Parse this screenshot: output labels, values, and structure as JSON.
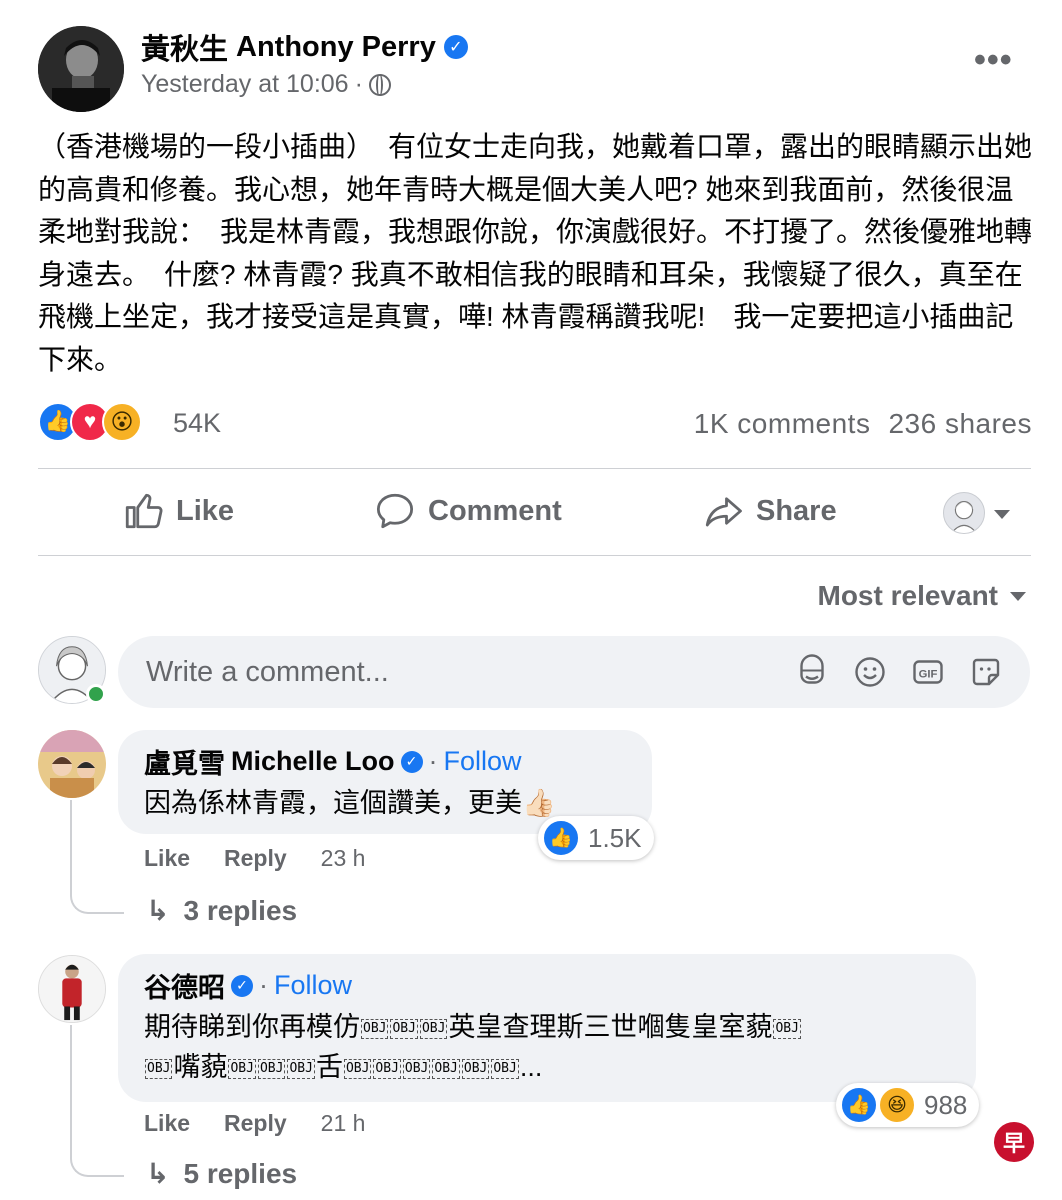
{
  "post": {
    "author_cn": "黃秋生",
    "author_en": "Anthony Perry",
    "timestamp": "Yesterday at 10:06",
    "separator": "·",
    "more_label": "•••",
    "text": "（香港機場的一段小插曲）　有位女士走向我，她戴着口罩，露出的眼睛顯示出她的高貴和修養。我心想，她年青時大概是個大美人吧? 她來到我面前，然後很温柔地對我說：　我是林青霞，我想跟你說，你演戲很好。不打擾了。然後優雅地轉身遠去。　什麼? 林青霞? 我真不敢相信我的眼睛和耳朵，我懷疑了很久，真至在飛機上坐定，我才接受這是真實，嘩! 林青霞稱讚我呢!　我一定要把這小插曲記下來。",
    "reaction_count": "54K",
    "reaction_icons": [
      "like-icon",
      "love-icon",
      "wow-icon"
    ],
    "comments_count": "1K comments",
    "shares_count": "236 shares"
  },
  "actions": {
    "like": "Like",
    "comment": "Comment",
    "share": "Share"
  },
  "sort_label": "Most relevant",
  "composer": {
    "placeholder": "Write a comment..."
  },
  "comments": [
    {
      "name_cn": "盧覓雪",
      "name_en": "Michelle Loo",
      "follow": "Follow",
      "text": "因為係林青霞，這個讚美，更美👍🏻",
      "reaction_count": "1.5K",
      "like": "Like",
      "reply": "Reply",
      "time": "23 h",
      "replies": "3 replies"
    },
    {
      "name_cn": "谷德昭",
      "follow": "Follow",
      "text_a": "期待睇到你再模仿",
      "text_b": "英皇查理斯三世嗰隻皇室藐",
      "text_c": "嘴藐",
      "text_d": "舌",
      "text_e": "...",
      "obj_label": "OBJ",
      "reaction_count": "988",
      "like": "Like",
      "reply": "Reply",
      "time": "21 h",
      "replies": "5 replies"
    }
  ],
  "watermark": "早",
  "colors": {
    "facebook_blue": "#1877f2",
    "secondary_text": "#65676b",
    "bubble_bg": "#f0f2f5",
    "online_green": "#31a24c"
  }
}
